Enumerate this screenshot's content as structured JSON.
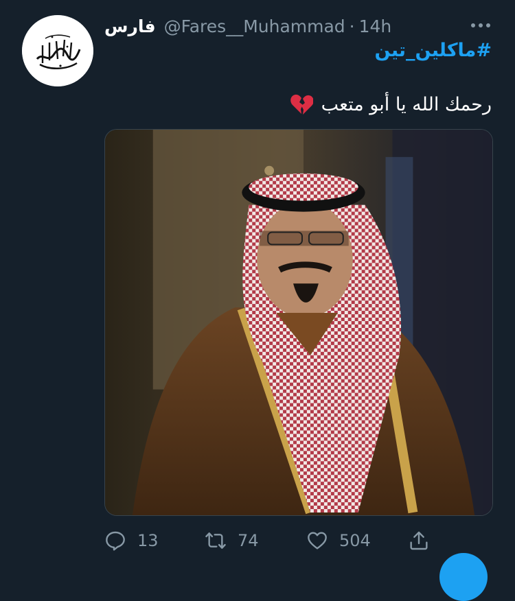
{
  "tweet": {
    "display_name": "فارس",
    "handle": "@Fares__Muhammad",
    "separator": "·",
    "time": "14h",
    "hashtag": "#ماكلين_تين",
    "text": "رحمك الله يا أبو متعب",
    "emoji": "broken-heart-icon"
  },
  "actions": {
    "reply_count": "13",
    "retweet_count": "74",
    "like_count": "504"
  },
  "colors": {
    "background": "#15202b",
    "accent": "#1da1f2",
    "secondary_text": "#8899a6"
  }
}
